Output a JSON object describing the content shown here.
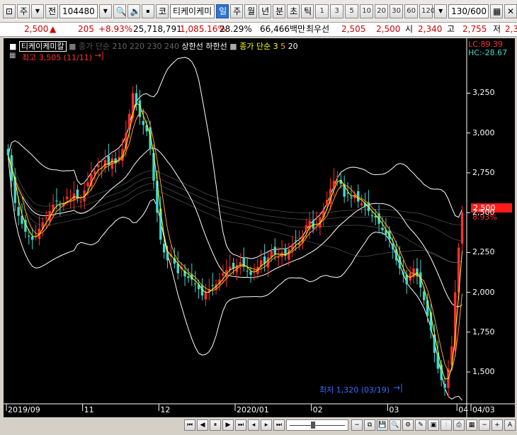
{
  "toolbar": {
    "period_label": "주",
    "prev_label": "전",
    "code": "104480",
    "stock_badge": "코",
    "stock_name": "티케이케미",
    "periods": [
      "일",
      "주",
      "월",
      "년",
      "분",
      "초",
      "틱"
    ],
    "intervals": [
      "1",
      "3",
      "5",
      "10",
      "20",
      "30",
      "60",
      "120"
    ],
    "count": "130",
    "total": "/600"
  },
  "quote": {
    "price": "2,500",
    "arrow": "▲",
    "change": "205",
    "pct": "+8.93%",
    "volume": "25,718,791",
    "vol_pct": "1,085.16%",
    "turnover": "28.29%",
    "amount": "66,466백만",
    "best_ask_label": "최우선",
    "ask": "2,505",
    "bid": "2,500",
    "open_label": "시",
    "open": "2,340",
    "high_label": "고",
    "high": "2,755",
    "low_label": "저",
    "low": "2,3"
  },
  "chart": {
    "legend_name": "티케이케미칼",
    "legend_ma_label": "종가 단순",
    "legend_ma_periods": "210 220 230 240",
    "legend_upper": "상한선",
    "legend_lower": "하한선",
    "legend_ma2_label": "종가 단순",
    "legend_ma2_periods": [
      "3",
      "5",
      "20"
    ],
    "high_note": "최고 3,505 (11/11)",
    "low_note": "최저 1,320 (03/19)",
    "lc": "LC:89.39",
    "hc": "HC:-28.67",
    "price_badge": "2,500",
    "pct_badge": "8.93%",
    "y_ticks": [
      "3,250",
      "3,000",
      "2,750",
      "2,500",
      "2,250",
      "2,000",
      "1,750",
      "1,500"
    ],
    "x_ticks": [
      "2019/09",
      "11",
      "12",
      "2020/01",
      "02",
      "03",
      "04",
      "04/03"
    ],
    "colors": {
      "up": "#ff2e2e",
      "down": "#3fd9d0",
      "ma3": "#ffff00",
      "ma5": "#ff9b3a",
      "ma20": "#ffffff",
      "band": "#ffffff",
      "ma_long": "#b0b0b0"
    }
  },
  "chart_data": {
    "type": "candlestick",
    "ylim": [
      1300,
      3550
    ],
    "y_ticks": [
      1500,
      1750,
      2000,
      2250,
      2500,
      2750,
      3000,
      3250
    ],
    "closes": [
      2860,
      2700,
      2560,
      2480,
      2430,
      2380,
      2350,
      2330,
      2360,
      2400,
      2440,
      2470,
      2510,
      2550,
      2570,
      2540,
      2560,
      2600,
      2580,
      2620,
      2590,
      2570,
      2640,
      2690,
      2740,
      2760,
      2800,
      2780,
      2830,
      2800,
      2840,
      2810,
      2850,
      2900,
      3000,
      3120,
      3250,
      3180,
      3100,
      3050,
      3010,
      2900,
      2700,
      2500,
      2330,
      2250,
      2200,
      2240,
      2180,
      2120,
      2160,
      2100,
      2090,
      2080,
      2050,
      2020,
      1980,
      2000,
      2020,
      2040,
      2050,
      2080,
      2120,
      2140,
      2160,
      2150,
      2170,
      2190,
      2160,
      2130,
      2110,
      2140,
      2160,
      2200,
      2180,
      2220,
      2260,
      2240,
      2220,
      2250,
      2230,
      2270,
      2300,
      2320,
      2310,
      2360,
      2420,
      2450,
      2400,
      2430,
      2470,
      2520,
      2580,
      2650,
      2700,
      2730,
      2680,
      2600,
      2620,
      2590,
      2610,
      2570,
      2560,
      2540,
      2510,
      2480,
      2470,
      2430,
      2390,
      2360,
      2330,
      2270,
      2200,
      2150,
      2110,
      2050,
      2120,
      2150,
      2100,
      2030,
      1950,
      1850,
      1760,
      1620,
      1520,
      1450,
      1400,
      1520,
      1660,
      2000,
      2280,
      2500
    ],
    "series": [
      {
        "name": "티케이케미칼"
      }
    ]
  }
}
